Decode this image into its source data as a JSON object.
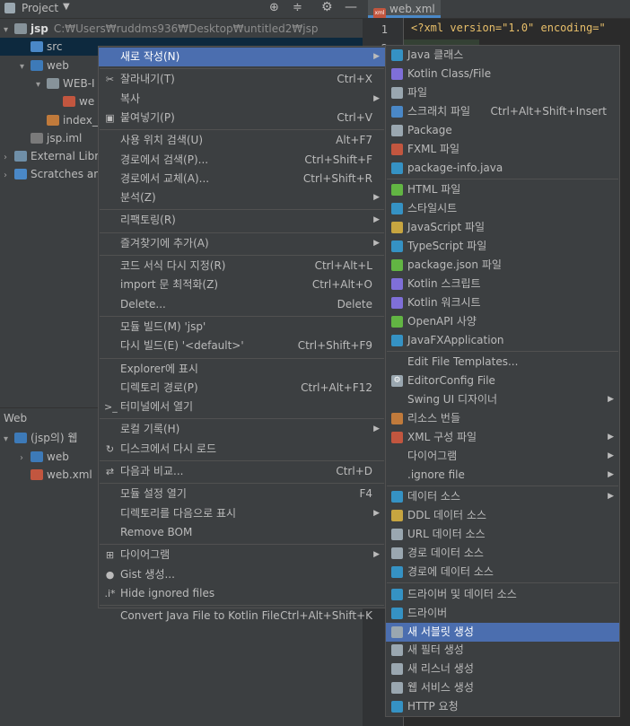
{
  "project_panel": {
    "title": "Project",
    "tree": [
      {
        "name": "root",
        "arrow": "▾",
        "label": "jsp",
        "path": "C:₩Users₩ruddms936₩Desktop₩untitled2₩jsp",
        "icon": "folder-icon",
        "depth": 0
      },
      {
        "name": "src",
        "arrow": "",
        "label": "src",
        "icon": "source-folder-icon",
        "depth": 1,
        "selected": true
      },
      {
        "name": "web",
        "arrow": "▾",
        "label": "web",
        "icon": "web-folder-icon",
        "depth": 1
      },
      {
        "name": "web-inf",
        "arrow": "▾",
        "label": "WEB-I",
        "icon": "folder-icon",
        "depth": 2
      },
      {
        "name": "web-xml-inner",
        "arrow": "",
        "label": "we",
        "icon": "xml-file-icon",
        "depth": 3
      },
      {
        "name": "index-jsp",
        "arrow": "",
        "label": "index_",
        "icon": "jsp-file-icon",
        "depth": 2
      },
      {
        "name": "jsp-iml",
        "arrow": "",
        "label": "jsp.iml",
        "icon": "iml-file-icon",
        "depth": 1
      },
      {
        "name": "external-libs",
        "arrow": "›",
        "label": "External Libra",
        "icon": "library-icon",
        "depth": 0
      },
      {
        "name": "scratches",
        "arrow": "›",
        "label": "Scratches an",
        "icon": "scratches-icon",
        "depth": 0
      }
    ]
  },
  "web_panel": {
    "title": "Web",
    "tree": [
      {
        "name": "jsp-web",
        "arrow": "▾",
        "label": "(jsp의) 웹",
        "depth": 0
      },
      {
        "name": "web-folder",
        "arrow": "›",
        "label": "web",
        "depth": 1
      },
      {
        "name": "web-xml",
        "arrow": "",
        "label": "web.xml",
        "depth": 1
      }
    ]
  },
  "editor": {
    "tab_label": "web.xml",
    "lines": [
      {
        "no": "1",
        "text": "<?xml version=\"1.0\" encoding=\""
      },
      {
        "no": "2",
        "text": ""
      }
    ]
  },
  "context_menu": {
    "items": [
      {
        "label": "새로 작성(N)",
        "shortcut": "",
        "submenu": true,
        "selected": true,
        "icon": ""
      },
      {
        "sep": true
      },
      {
        "label": "잘라내기(T)",
        "shortcut": "Ctrl+X",
        "icon": "cut-icon"
      },
      {
        "label": "복사",
        "shortcut": "",
        "submenu": true,
        "icon": ""
      },
      {
        "label": "붙여넣기(P)",
        "shortcut": "Ctrl+V",
        "icon": "paste-icon"
      },
      {
        "sep": true
      },
      {
        "label": "사용 위치 검색(U)",
        "shortcut": "Alt+F7",
        "icon": ""
      },
      {
        "label": "경로에서 검색(P)...",
        "shortcut": "Ctrl+Shift+F",
        "icon": ""
      },
      {
        "label": "경로에서 교체(A)...",
        "shortcut": "Ctrl+Shift+R",
        "icon": ""
      },
      {
        "label": "분석(Z)",
        "shortcut": "",
        "submenu": true,
        "icon": ""
      },
      {
        "sep": true
      },
      {
        "label": "리팩토링(R)",
        "shortcut": "",
        "submenu": true,
        "icon": ""
      },
      {
        "sep": true
      },
      {
        "label": "즐겨찾기에 추가(A)",
        "shortcut": "",
        "submenu": true,
        "icon": ""
      },
      {
        "sep": true
      },
      {
        "label": "코드 서식 다시 지정(R)",
        "shortcut": "Ctrl+Alt+L",
        "icon": ""
      },
      {
        "label": "import 문 최적화(Z)",
        "shortcut": "Ctrl+Alt+O",
        "icon": ""
      },
      {
        "label": "Delete...",
        "shortcut": "Delete",
        "icon": ""
      },
      {
        "sep": true
      },
      {
        "label": "모듈 빌드(M) 'jsp'",
        "shortcut": "",
        "icon": ""
      },
      {
        "label": "다시 빌드(E) '<default>'",
        "shortcut": "Ctrl+Shift+F9",
        "icon": ""
      },
      {
        "sep": true
      },
      {
        "label": "Explorer에 표시",
        "shortcut": "",
        "icon": ""
      },
      {
        "label": "디렉토리 경로(P)",
        "shortcut": "Ctrl+Alt+F12",
        "icon": ""
      },
      {
        "label": "터미널에서 열기",
        "shortcut": "",
        "icon": "terminal-icon"
      },
      {
        "sep": true
      },
      {
        "label": "로컬 기록(H)",
        "shortcut": "",
        "submenu": true,
        "icon": ""
      },
      {
        "label": "디스크에서 다시 로드",
        "shortcut": "",
        "icon": "reload-icon"
      },
      {
        "sep": true
      },
      {
        "label": "다음과 비교...",
        "shortcut": "Ctrl+D",
        "icon": "compare-icon"
      },
      {
        "sep": true
      },
      {
        "label": "모듈 설정 열기",
        "shortcut": "F4",
        "icon": ""
      },
      {
        "label": "디렉토리를 다음으로 표시",
        "shortcut": "",
        "submenu": true,
        "icon": ""
      },
      {
        "label": "Remove BOM",
        "shortcut": "",
        "icon": ""
      },
      {
        "sep": true
      },
      {
        "label": "다이어그램",
        "shortcut": "",
        "submenu": true,
        "icon": "diagram-icon"
      },
      {
        "label": "Gist 생성...",
        "shortcut": "",
        "icon": "github-icon"
      },
      {
        "label": "Hide ignored files",
        "shortcut": "",
        "icon": "ignore-icon"
      },
      {
        "sep": true
      },
      {
        "label": "Convert Java File to Kotlin File",
        "shortcut": "Ctrl+Alt+Shift+K",
        "icon": ""
      }
    ]
  },
  "submenu": {
    "items": [
      {
        "label": "Java 클래스",
        "icon": "java-class-icon",
        "color": "#3592c4"
      },
      {
        "label": "Kotlin Class/File",
        "icon": "kotlin-icon",
        "color": "#7f6fd8"
      },
      {
        "label": "파일",
        "icon": "file-icon",
        "color": "#9aa7b0"
      },
      {
        "label": "스크래치 파일",
        "shortcut": "Ctrl+Alt+Shift+Insert",
        "icon": "scratch-file-icon",
        "color": "#4a88c7"
      },
      {
        "label": "Package",
        "icon": "package-icon",
        "color": "#9aa7b0"
      },
      {
        "label": "FXML 파일",
        "icon": "fxml-icon",
        "color": "#c2563f"
      },
      {
        "label": "package-info.java",
        "icon": "package-info-icon",
        "color": "#3592c4"
      },
      {
        "sep": true
      },
      {
        "label": "HTML 파일",
        "icon": "html-icon",
        "color": "#62b543"
      },
      {
        "label": "스타일시트",
        "icon": "css-icon",
        "color": "#3592c4"
      },
      {
        "label": "JavaScript 파일",
        "icon": "javascript-icon",
        "color": "#c7a540"
      },
      {
        "label": "TypeScript 파일",
        "icon": "typescript-icon",
        "color": "#3592c4"
      },
      {
        "label": "package.json 파일",
        "icon": "npm-icon",
        "color": "#62b543"
      },
      {
        "label": "Kotlin 스크립트",
        "icon": "kotlin-script-icon",
        "color": "#7f6fd8"
      },
      {
        "label": "Kotlin 워크시트",
        "icon": "kotlin-worksheet-icon",
        "color": "#7f6fd8"
      },
      {
        "label": "OpenAPI 사양",
        "icon": "openapi-icon",
        "color": "#62b543"
      },
      {
        "label": "JavaFXApplication",
        "icon": "javafx-icon",
        "color": "#3592c4"
      },
      {
        "sep": true
      },
      {
        "label": "Edit File Templates...",
        "icon": ""
      },
      {
        "label": "EditorConfig File",
        "icon": "gear-icon",
        "color": "#9aa7b0"
      },
      {
        "label": "Swing UI 디자이너",
        "icon": "",
        "submenu": true
      },
      {
        "label": "리소스 번들",
        "icon": "resource-bundle-icon",
        "color": "#c07a3b"
      },
      {
        "label": "XML 구성 파일",
        "icon": "xml-config-icon",
        "color": "#c2563f",
        "submenu": true
      },
      {
        "label": "다이어그램",
        "icon": "",
        "submenu": true
      },
      {
        "label": ".ignore file",
        "icon": "ignore-file-icon",
        "color": "#3c3f41",
        "submenu": true
      },
      {
        "sep": true
      },
      {
        "label": "데이터 소스",
        "icon": "datasource-icon",
        "color": "#3592c4",
        "submenu": true
      },
      {
        "label": "DDL 데이터 소스",
        "icon": "ddl-icon",
        "color": "#c7a540"
      },
      {
        "label": "URL 데이터 소스",
        "icon": "url-datasource-icon",
        "color": "#9aa7b0"
      },
      {
        "label": "경로 데이터 소스",
        "icon": "folder-datasource-icon",
        "color": "#9aa7b0"
      },
      {
        "label": "경로에 데이터 소스",
        "icon": "path-datasource-icon",
        "color": "#3592c4"
      },
      {
        "sep": true
      },
      {
        "label": "드라이버 및 데이터 소스",
        "icon": "driver-datasource-icon",
        "color": "#3592c4"
      },
      {
        "label": "드라이버",
        "icon": "driver-icon",
        "color": "#3592c4"
      },
      {
        "label": "새 서블릿 생성",
        "icon": "servlet-icon",
        "color": "#9aa7b0",
        "selected": true
      },
      {
        "label": "새 필터 생성",
        "icon": "filter-icon",
        "color": "#9aa7b0"
      },
      {
        "label": "새 리스너 생성",
        "icon": "listener-icon",
        "color": "#9aa7b0"
      },
      {
        "label": "웹 서비스 생성",
        "icon": "web-service-icon",
        "color": "#9aa7b0"
      },
      {
        "label": "HTTP 요청",
        "icon": "http-request-icon",
        "color": "#3592c4"
      }
    ]
  }
}
